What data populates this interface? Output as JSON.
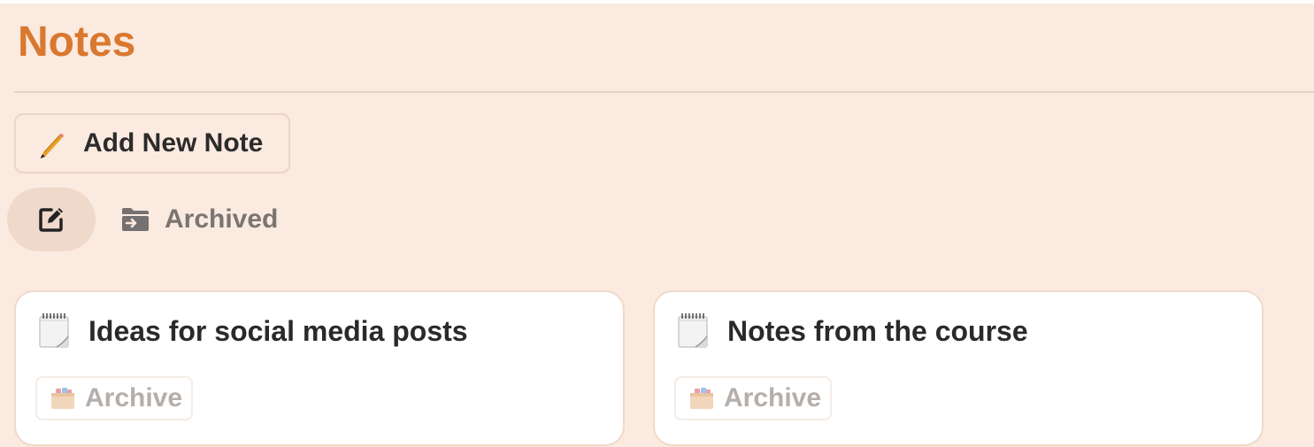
{
  "header": {
    "title": "Notes"
  },
  "toolbar": {
    "add_note_label": "Add New Note",
    "add_note_icon": "pencil-icon"
  },
  "tabs": {
    "notes_icon": "edit-square-icon",
    "archived_label": "Archived",
    "archived_icon": "folder-archive-icon"
  },
  "notes": [
    {
      "title": "Ideas for social media posts",
      "icon": "spiral-notepad-icon",
      "archive_label": "Archive",
      "archive_icon": "card-file-box-icon"
    },
    {
      "title": "Notes from the course",
      "icon": "spiral-notepad-icon",
      "archive_label": "Archive",
      "archive_icon": "card-file-box-icon"
    }
  ],
  "colors": {
    "page_background": "#fbeadf",
    "accent": "#d9782f",
    "card_background": "#ffffff",
    "active_tab": "#efd9cb"
  }
}
